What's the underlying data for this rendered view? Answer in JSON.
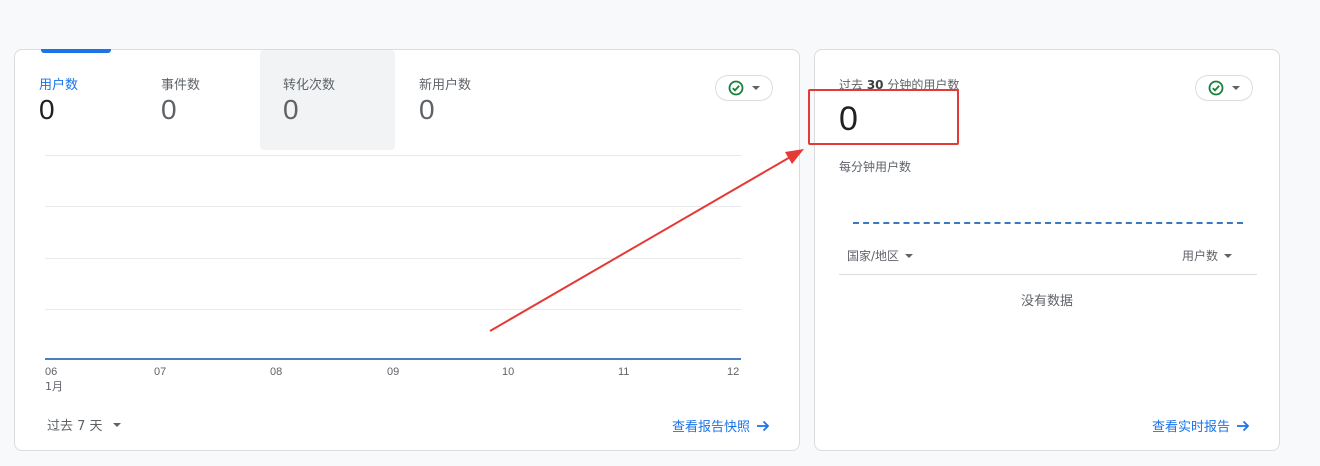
{
  "overview": {
    "metrics": [
      {
        "label": "用户数",
        "value": "0"
      },
      {
        "label": "事件数",
        "value": "0"
      },
      {
        "label": "转化次数",
        "value": "0"
      },
      {
        "label": "新用户数",
        "value": "0"
      }
    ],
    "x_ticks": [
      "06",
      "07",
      "08",
      "09",
      "10",
      "11",
      "12"
    ],
    "x_month": "1月",
    "date_range": "过去 7 天",
    "snapshot_link": "查看报告快照"
  },
  "realtime": {
    "title_prefix": "过去 ",
    "title_number": "30",
    "title_suffix": " 分钟的用户数",
    "value": "0",
    "subtitle": "每分钟用户数",
    "col_country": "国家/地区",
    "col_users": "用户数",
    "empty_text": "没有数据",
    "realtime_link": "查看实时报告"
  },
  "colors": {
    "accent": "#1a73e8",
    "status_ok": "#188038",
    "annotation": "#e53935"
  }
}
